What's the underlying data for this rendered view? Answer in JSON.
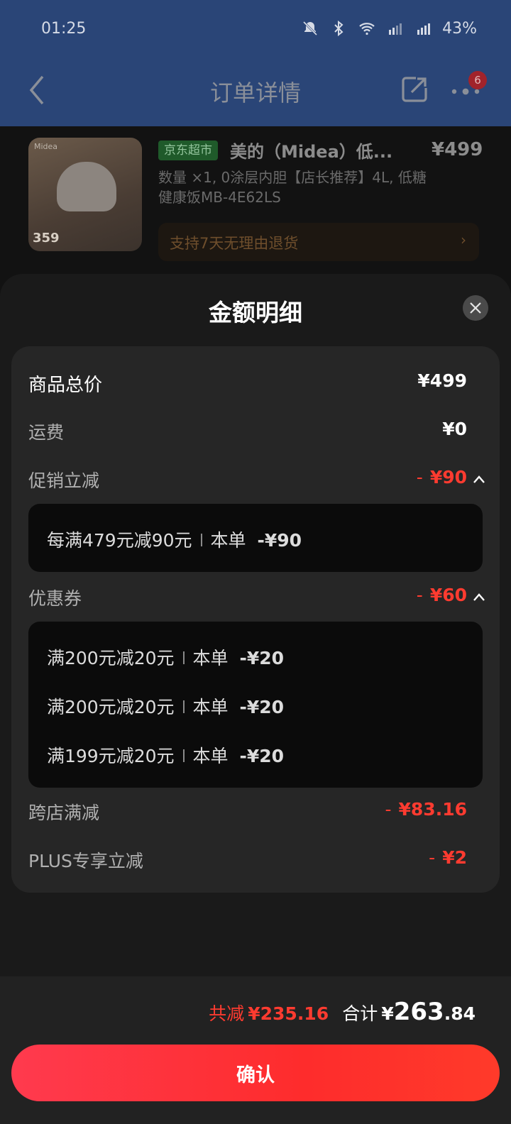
{
  "status_bar": {
    "time": "01:25",
    "battery": "43%",
    "icons": [
      "mute-bell-icon",
      "bluetooth-icon",
      "wifi-icon",
      "5g-signal-icon",
      "5g-signal-icon"
    ]
  },
  "header": {
    "title": "订单详情",
    "badge_count": "6",
    "icons": [
      "back-icon",
      "share-icon",
      "more-icon"
    ]
  },
  "product": {
    "shop_tag": "京东超市",
    "name": "美的（Midea）低...",
    "price": "¥499",
    "desc": "数量 ×1, 0涂层内胆【店长推荐】4L, 低糖健康饭MB-4E62LS",
    "return_policy": "支持7天无理由退货",
    "thumb_brand": "Midea",
    "thumb_price": "359"
  },
  "sheet": {
    "title": "金额明细",
    "rows": {
      "goods_total": {
        "label": "商品总价",
        "value": "¥499"
      },
      "shipping": {
        "label": "运费",
        "value": "¥0"
      },
      "promo": {
        "label": "促销立减",
        "value": "¥90"
      },
      "coupon": {
        "label": "优惠券",
        "value": "¥60"
      },
      "cross_store": {
        "label": "跨店满减",
        "value": "¥83.16"
      },
      "plus": {
        "label": "PLUS专享立减",
        "value": "¥2"
      }
    },
    "minus_sign": "-",
    "promo_details": [
      {
        "rule": "每满479元减90元",
        "this_order": "本单",
        "amount": "-¥90"
      }
    ],
    "coupon_details": [
      {
        "rule": "满200元减20元",
        "this_order": "本单",
        "amount": "-¥20"
      },
      {
        "rule": "满200元减20元",
        "this_order": "本单",
        "amount": "-¥20"
      },
      {
        "rule": "满199元减20元",
        "this_order": "本单",
        "amount": "-¥20"
      }
    ]
  },
  "footer": {
    "saved_label": "共减",
    "saved_value": "¥235.16",
    "total_label": "合计",
    "total_currency": "¥",
    "total_int": "263",
    "total_dec": ".84",
    "confirm_label": "确认"
  },
  "colors": {
    "accent_red": "#ff3b30",
    "header_blue": "#2a4577",
    "sheet_bg": "#1a1a1a",
    "card_bg": "#262626"
  }
}
